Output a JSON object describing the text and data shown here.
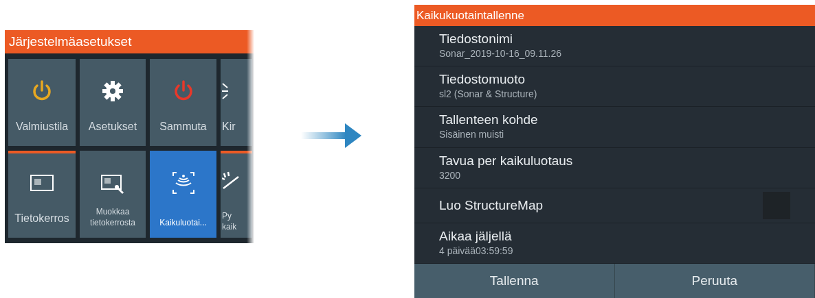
{
  "system_menu": {
    "title": "Järjestelmäasetukset",
    "tiles": [
      {
        "label": "Valmiustila",
        "kind": "standby",
        "selected": false,
        "accent": false
      },
      {
        "label": "Asetukset",
        "kind": "settings",
        "selected": false,
        "accent": false
      },
      {
        "label": "Sammuta",
        "kind": "shutdown",
        "selected": false,
        "accent": false
      },
      {
        "label": "Kir",
        "kind": "brightness",
        "selected": false,
        "accent": false
      },
      {
        "label": "Tietokerros",
        "kind": "overlay",
        "selected": false,
        "accent": true
      },
      {
        "label": "Muokkaa tietokerrosta",
        "kind": "edit-overlay",
        "selected": false,
        "accent": false
      },
      {
        "label": "Kaikuluotai...",
        "kind": "sonar-log",
        "selected": true,
        "accent": false
      },
      {
        "label": "Py kaik",
        "kind": "stop",
        "selected": false,
        "accent": true
      }
    ]
  },
  "sonar_log_dialog": {
    "title": "Kaikukuotaintallenne",
    "rows": [
      {
        "kind": "field",
        "label": "Tiedostonimi",
        "value": "Sonar_2019-10-16_09.11.26"
      },
      {
        "kind": "field",
        "label": "Tiedostomuoto",
        "value": "sl2 (Sonar & Structure)"
      },
      {
        "kind": "field",
        "label": "Tallenteen kohde",
        "value": "Sisäinen muisti"
      },
      {
        "kind": "field",
        "label": "Tavua per kaikuluotaus",
        "value": "3200"
      },
      {
        "kind": "checkbox",
        "label": "Luo StructureMap",
        "checked": false
      },
      {
        "kind": "field",
        "label": "Aikaa jäljellä",
        "value": "4 päivää03:59:59"
      }
    ],
    "buttons": [
      "Tallenna",
      "Peruuta"
    ]
  }
}
